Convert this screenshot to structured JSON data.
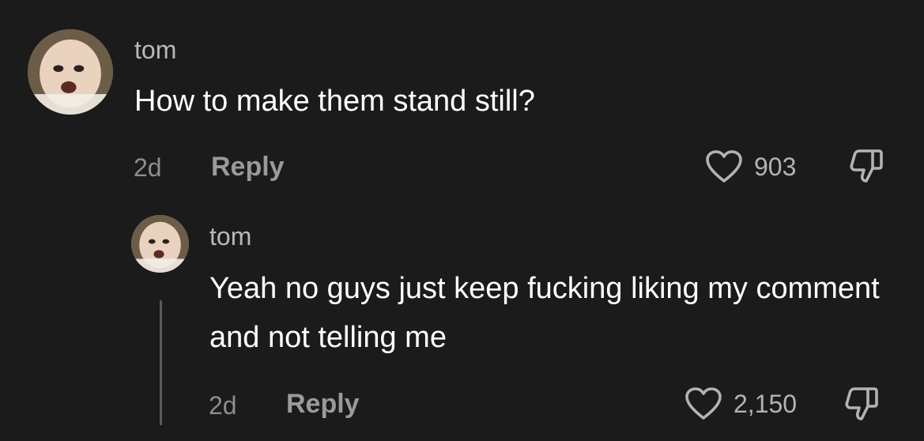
{
  "comments": [
    {
      "username": "tom",
      "text": "How to make them stand still?",
      "time": "2d",
      "reply_label": "Reply",
      "likes": "903"
    },
    {
      "username": "tom",
      "text": "Yeah no guys just keep fucking liking my comment and not telling me",
      "time": "2d",
      "reply_label": "Reply",
      "likes": "2,150"
    }
  ],
  "icons": {
    "like": "heart-icon",
    "dislike": "thumbs-down-icon"
  },
  "colors": {
    "background": "#1b1b1b",
    "text": "#ffffff",
    "secondary": "#9a9a9a"
  }
}
